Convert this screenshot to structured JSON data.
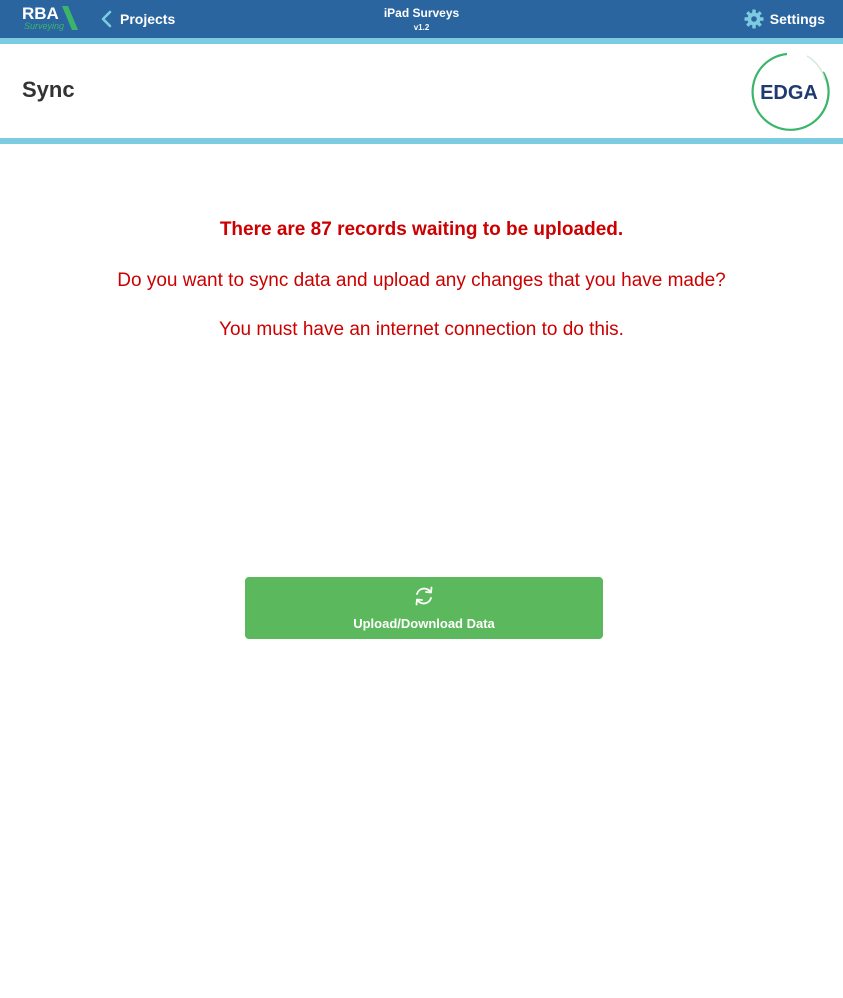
{
  "topbar": {
    "brand": {
      "name": "RBA",
      "sub": "Surveying"
    },
    "back_label": "Projects",
    "app_title": "iPad Surveys",
    "app_version": "v1.2",
    "settings_label": "Settings",
    "icons": {
      "back": "chevron-left-icon",
      "settings": "gear-icon"
    }
  },
  "header": {
    "title": "Sync",
    "logo_text": "EDGA"
  },
  "main": {
    "records_message": "There are 87 records waiting to be uploaded.",
    "question": "Do you want to sync data and upload any changes that you have made?",
    "connection_note": "You must have an internet connection to do this.",
    "sync_button": {
      "label": "Upload/Download Data",
      "icon": "sync-icon"
    }
  },
  "colors": {
    "topbar": "#2b65a0",
    "stripe": "#7ccbe0",
    "message": "#cc0000",
    "button": "#5cb85c",
    "logo_ring": "#3bb56a",
    "logo_text": "#1f3a6e"
  }
}
